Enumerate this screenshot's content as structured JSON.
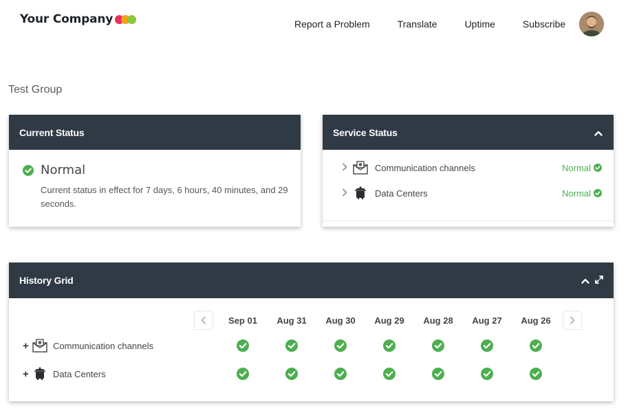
{
  "header": {
    "logo_text": "Your Company",
    "logo_colors": [
      "#e8305a",
      "#f5a11a",
      "#8cc63f"
    ],
    "nav": [
      "Report a Problem",
      "Translate",
      "Uptime",
      "Subscribe"
    ]
  },
  "group_title": "Test Group",
  "current_status": {
    "title": "Current Status",
    "status": "Normal",
    "description": "Current status in effect for 7 days, 6 hours, 40 minutes, and 29 seconds."
  },
  "service_status": {
    "title": "Service Status",
    "services": [
      {
        "name": "Communication channels",
        "state": "Normal",
        "icon": "envelope-icon"
      },
      {
        "name": "Data Centers",
        "state": "Normal",
        "icon": "server-icon"
      }
    ]
  },
  "history_grid": {
    "title": "History Grid",
    "dates": [
      "Sep 01",
      "Aug 31",
      "Aug 30",
      "Aug 29",
      "Aug 28",
      "Aug 27",
      "Aug 26"
    ],
    "rows": [
      {
        "name": "Communication channels",
        "icon": "envelope-icon"
      },
      {
        "name": "Data Centers",
        "icon": "server-icon"
      }
    ]
  },
  "colors": {
    "header_bg": "#2f3a45",
    "ok_green": "#4caf50"
  }
}
